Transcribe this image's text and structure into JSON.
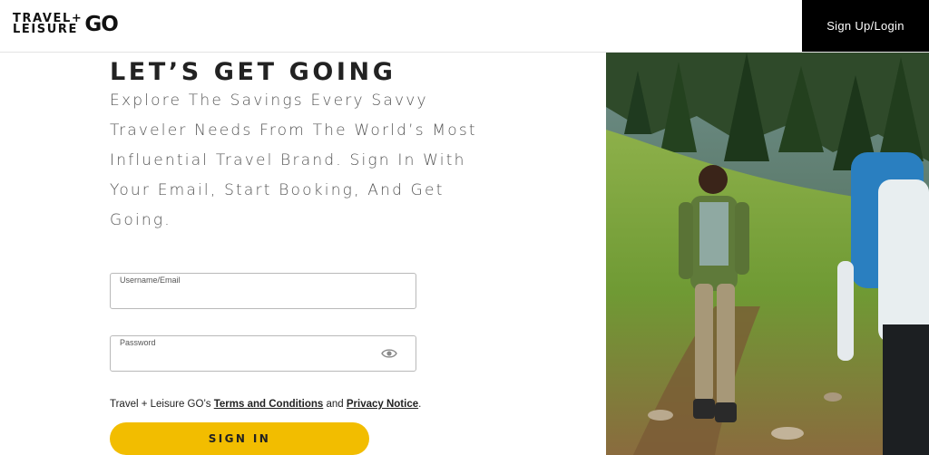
{
  "header": {
    "logo_line1": "TRAVEL+",
    "logo_line2": "LEISURE",
    "logo_go": "GO",
    "signup_label": "Sign Up/Login"
  },
  "main": {
    "title": "LET’S GET GOING",
    "subtitle": "Explore The Savings Every Savvy Traveler Needs From The World’s Most Influential Travel Brand. Sign In With Your Email, Start Booking, And Get Going."
  },
  "form": {
    "username_label": "Username/Email",
    "username_value": "",
    "password_label": "Password",
    "password_value": "",
    "terms_prefix": "Travel + Leisure GO’s ",
    "terms_link": "Terms and Conditions",
    "terms_and": " and ",
    "privacy_link": "Privacy Notice",
    "terms_suffix": ".",
    "signin_label": "SIGN IN"
  },
  "icons": {
    "password_toggle": "eye-icon"
  }
}
